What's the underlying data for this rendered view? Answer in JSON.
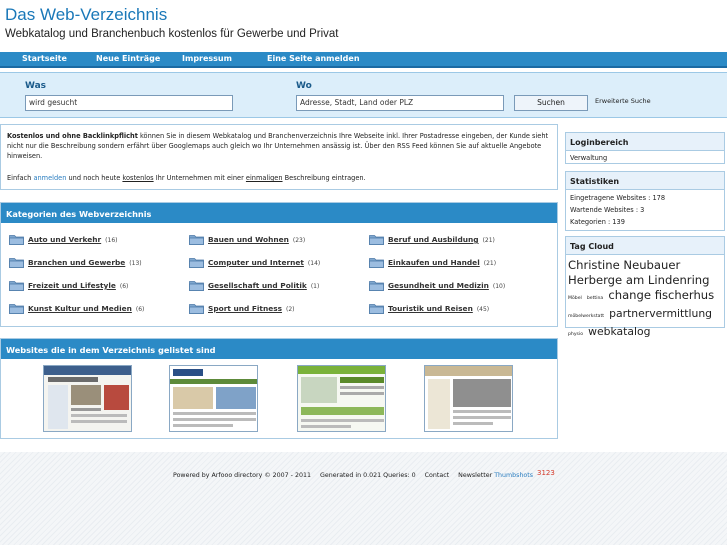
{
  "header": {
    "title": "Das Web-Verzeichnis",
    "tagline": "Webkatalog und Branchenbuch kostenlos für Gewerbe und Privat"
  },
  "nav": {
    "start": "Startseite",
    "new_entries": "Neue Einträge",
    "impressum": "Impressum",
    "submit": "Eine Seite anmelden"
  },
  "search": {
    "label_what": "Was",
    "label_where": "Wo",
    "what_value": "wird gesucht",
    "where_value": "Adresse, Stadt, Land oder PLZ",
    "button": "Suchen",
    "advanced": "Erweiterte Suche"
  },
  "info": {
    "bold_intro": "Kostenlos und ohne Backlinkpflicht",
    "para1_rest": " können Sie in diesem Webkatalog und Branchenverzeichnis Ihre Webseite inkl. Ihrer Postadresse eingeben, der Kunde sieht nicht nur die Beschreibung sondern erfährt über Googlemaps auch gleich wo Ihr Unternehmen ansässig ist. Über den RSS Feed können Sie auf aktuelle Angebote hinweisen.",
    "p2_a": "Einfach ",
    "p2_link1": "anmelden",
    "p2_b": " und noch heute ",
    "p2_link2": "kostenlos",
    "p2_c": " Ihr Unternehmen mit einer ",
    "p2_link3": "einmaligen",
    "p2_d": " Beschreibung eintragen."
  },
  "categories": {
    "heading": "Kategorien des Webverzeichnis",
    "items": [
      {
        "name": "Auto und Verkehr",
        "count": "(16)"
      },
      {
        "name": "Bauen und Wohnen",
        "count": "(23)"
      },
      {
        "name": "Beruf und Ausbildung",
        "count": "(21)"
      },
      {
        "name": "Branchen und Gewerbe",
        "count": "(13)"
      },
      {
        "name": "Computer und Internet",
        "count": "(14)"
      },
      {
        "name": "Einkaufen und Handel",
        "count": "(21)"
      },
      {
        "name": "Freizeit und Lifestyle",
        "count": "(6)"
      },
      {
        "name": "Gesellschaft und Politik",
        "count": "(1)"
      },
      {
        "name": "Gesundheit und Medizin",
        "count": "(10)"
      },
      {
        "name": "Kunst Kultur und Medien",
        "count": "(6)"
      },
      {
        "name": "Sport und Fitness",
        "count": "(2)"
      },
      {
        "name": "Touristik und Reisen",
        "count": "(45)"
      }
    ]
  },
  "websites": {
    "heading": "Websites die in dem Verzeichnis gelistet sind"
  },
  "sidebar": {
    "login": {
      "title": "Loginbereich",
      "link": "Verwaltung"
    },
    "stats": {
      "title": "Statistiken",
      "websites": "Eingetragene Websites : 178",
      "waiting": "Wartende Websites : 3",
      "categories": "Kategorien : 139"
    },
    "tags": {
      "title": "Tag Cloud",
      "t1": "Christine Neubauer",
      "t2": "Herberge am Lindenring",
      "t3": "Möbel",
      "t4": "bettina",
      "t5": "change fischerhus",
      "t6": "möbelwerkstatt",
      "t7": "partnervermittlung",
      "t8": "physio",
      "t9": "webkatalog"
    }
  },
  "footer": {
    "powered": "Powered by Arfooo directory © 2007 - 2011",
    "generated": "Generated in 0.021 Queries: 0",
    "contact": "Contact",
    "newsletter": "Newsletter",
    "thumbshots": "Thumbshots",
    "counter": "3123"
  }
}
